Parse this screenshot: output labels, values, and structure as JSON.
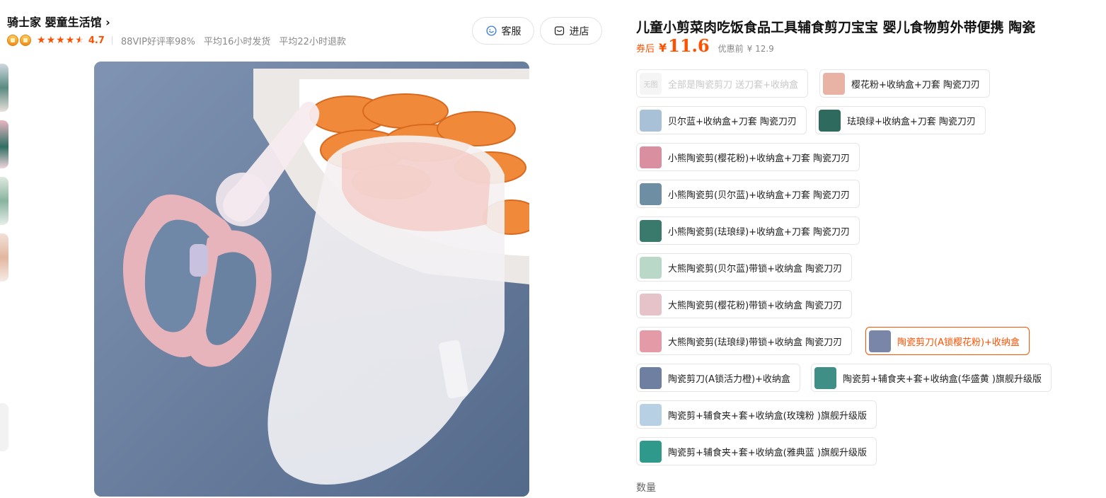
{
  "store": {
    "name": "骑士家 婴童生活馆 ›",
    "rating": "4.7",
    "good_rate": "88VIP好评率98%",
    "ship_time": "平均16小时发货",
    "refund_time": "平均22小时退款",
    "service_button": "客服",
    "shop_button": "进店"
  },
  "sidebar": {
    "partial_text": "",
    "partial_heart": ""
  },
  "product": {
    "title": "儿童小剪菜肉吃饭食品工具辅食剪刀宝宝 婴儿食物剪外带便携 陶瓷",
    "coupon_label": "券后",
    "currency": "¥",
    "price": "11.6",
    "original_label": "优惠前",
    "original_price": "¥ 12.9",
    "quantity_label": "数量"
  },
  "skus": [
    {
      "label": "全部是陶瓷剪刀 送刀套+收纳盒",
      "thumb_text": "无图",
      "state": "disabled",
      "color": "#f5f5f5"
    },
    {
      "label": "樱花粉+收纳盒+刀套 陶瓷刀刃",
      "state": "normal",
      "color": "#e8b3a5"
    },
    {
      "label": "贝尔蓝+收纳盒+刀套 陶瓷刀刃",
      "state": "normal",
      "color": "#a9c1d6"
    },
    {
      "label": "珐琅绿+收纳盒+刀套 陶瓷刀刃",
      "state": "normal",
      "color": "#2e6a5e"
    },
    {
      "label": "小熊陶瓷剪(樱花粉)+收纳盒+刀套 陶瓷刀刃",
      "state": "normal",
      "color": "#d98fa0"
    },
    {
      "label": "小熊陶瓷剪(贝尔蓝)+收纳盒+刀套 陶瓷刀刃",
      "state": "normal",
      "color": "#6d8ea3"
    },
    {
      "label": "小熊陶瓷剪(珐琅绿)+收纳盒+刀套 陶瓷刀刃",
      "state": "normal",
      "color": "#3a7a6c"
    },
    {
      "label": "大熊陶瓷剪(贝尔蓝)带锁+收纳盒 陶瓷刀刃",
      "state": "normal",
      "color": "#b9d8c8"
    },
    {
      "label": "大熊陶瓷剪(樱花粉)带锁+收纳盒 陶瓷刀刃",
      "state": "normal",
      "color": "#e6c3c8"
    },
    {
      "label": "大熊陶瓷剪(珐琅绿)带锁+收纳盒 陶瓷刀刃",
      "state": "normal",
      "color": "#e59aa8"
    },
    {
      "label": "陶瓷剪刀(A锁樱花粉)+收纳盒",
      "state": "selected",
      "color": "#7a86a8"
    },
    {
      "label": "陶瓷剪刀(A锁活力橙)+收纳盒",
      "state": "normal",
      "color": "#6e7fa1"
    },
    {
      "label": "陶瓷剪+辅食夹+套+收纳盒(华盛黄 )旗舰升级版",
      "state": "normal",
      "color": "#3f8f86"
    },
    {
      "label": "陶瓷剪+辅食夹+套+收纳盒(玫瑰粉 )旗舰升级版",
      "state": "normal",
      "color": "#b8d0e3"
    },
    {
      "label": "陶瓷剪+辅食夹+套+收纳盒(雅典蓝 )旗舰升级版",
      "state": "normal",
      "color": "#2f9a8c"
    }
  ],
  "colors": {
    "accent": "#ff5000",
    "border": "#e6e6e6"
  }
}
